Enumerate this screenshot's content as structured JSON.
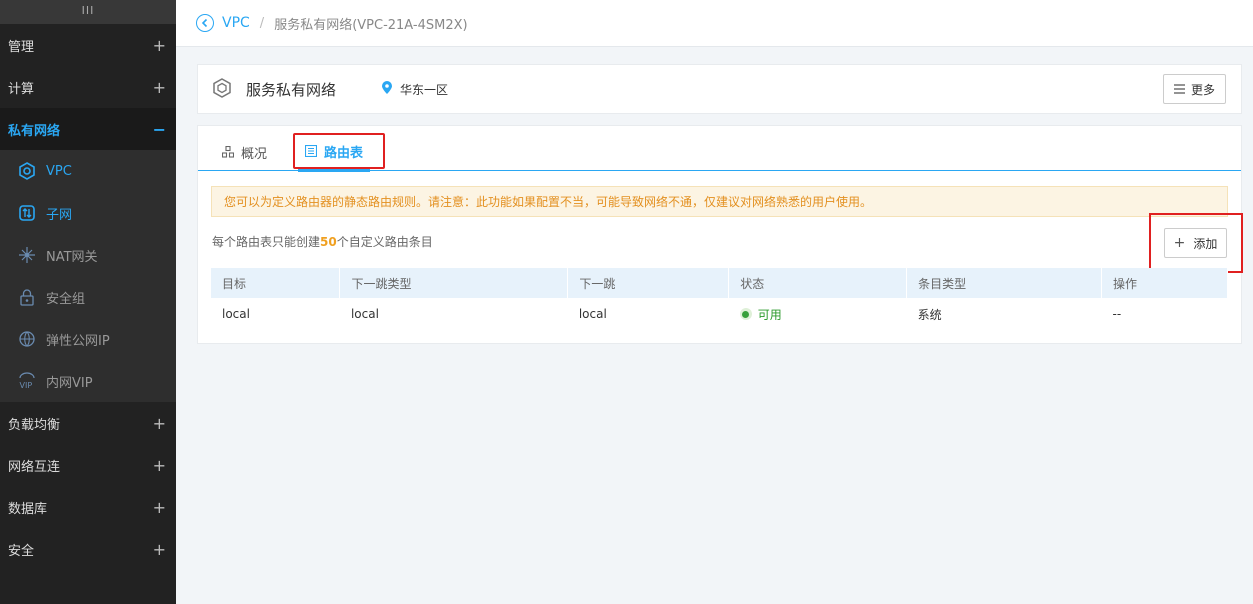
{
  "sidebar": {
    "toggle": "III",
    "groups_top": [
      {
        "label": "管理",
        "toggle": "+"
      },
      {
        "label": "计算",
        "toggle": "+"
      }
    ],
    "active_group": {
      "label": "私有网络",
      "toggle": "−"
    },
    "sub_items": [
      {
        "label": "VPC",
        "icon": "vpc-icon"
      },
      {
        "label": "子网",
        "icon": "subnet-icon"
      },
      {
        "label": "NAT网关",
        "icon": "nat-gateway-icon"
      },
      {
        "label": "安全组",
        "icon": "lock-icon"
      },
      {
        "label": "弹性公网IP",
        "icon": "globe-icon"
      },
      {
        "label": "内网VIP",
        "icon": "vip-icon"
      }
    ],
    "groups_bottom": [
      {
        "label": "负载均衡",
        "toggle": "+"
      },
      {
        "label": "网络互连",
        "toggle": "+"
      },
      {
        "label": "数据库",
        "toggle": "+"
      },
      {
        "label": "安全",
        "toggle": "+"
      }
    ]
  },
  "breadcrumb": {
    "root": "VPC",
    "separator": "/",
    "current": "服务私有网络(VPC-21A-4SM2X)"
  },
  "header": {
    "title": "服务私有网络",
    "region": "华东一区",
    "more_label": "更多"
  },
  "tabs": {
    "overview": "概况",
    "route_table": "路由表"
  },
  "notice": "您可以为定义路由器的静态路由规则。请注意：此功能如果配置不当，可能导致网络不通，仅建议对网络熟悉的用户使用。",
  "quota": {
    "prefix": "每个路由表只能创建",
    "count": "50",
    "suffix": "个自定义路由条目"
  },
  "add_label": "添加",
  "table": {
    "columns": [
      "目标",
      "下一跳类型",
      "下一跳",
      "状态",
      "条目类型",
      "操作"
    ],
    "rows": [
      {
        "target": "local",
        "next_hop_type": "local",
        "next_hop": "local",
        "status": "可用",
        "entry_type": "系统",
        "action": "--"
      }
    ]
  },
  "colors": {
    "accent": "#2aa7f3",
    "highlight_box": "#e02020",
    "notice_text": "#e39020",
    "status_ok": "#37a03a",
    "sidebar_bg": "#222222"
  }
}
